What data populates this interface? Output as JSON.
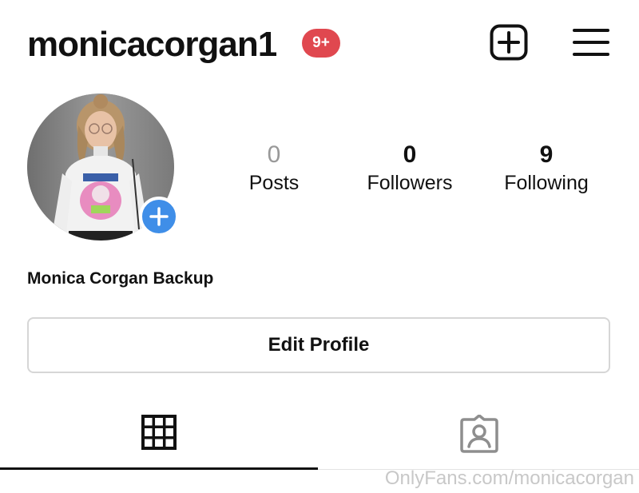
{
  "header": {
    "username": "monicacorgan1",
    "notification_badge": "9+",
    "badge_color": "#e0484f",
    "new_post_icon": "plus-square-icon",
    "menu_icon": "hamburger-menu-icon"
  },
  "profile": {
    "avatar_add_icon": "plus-icon",
    "avatar_add_color": "#3f8ee8",
    "display_name": "Monica Corgan Backup"
  },
  "stats": [
    {
      "value": "0",
      "label": "Posts"
    },
    {
      "value": "0",
      "label": "Followers"
    },
    {
      "value": "9",
      "label": "Following"
    }
  ],
  "actions": {
    "edit_profile_label": "Edit Profile"
  },
  "tabs": [
    {
      "icon": "grid-icon",
      "active": true
    },
    {
      "icon": "tagged-person-icon",
      "active": false
    }
  ],
  "watermark": "OnlyFans.com/monicacorgan"
}
